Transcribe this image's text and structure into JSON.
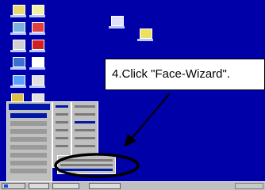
{
  "callout": {
    "text": "4.Click \"Face-Wizard\"."
  },
  "colors": {
    "desktop": "#0000a8",
    "menu": "#c0c0c0",
    "highlight": "#0018a8",
    "callout_border": "#000000"
  },
  "icons": {
    "desktop_icon": "desktop-shortcut-icon",
    "start": "windows-start-icon"
  }
}
